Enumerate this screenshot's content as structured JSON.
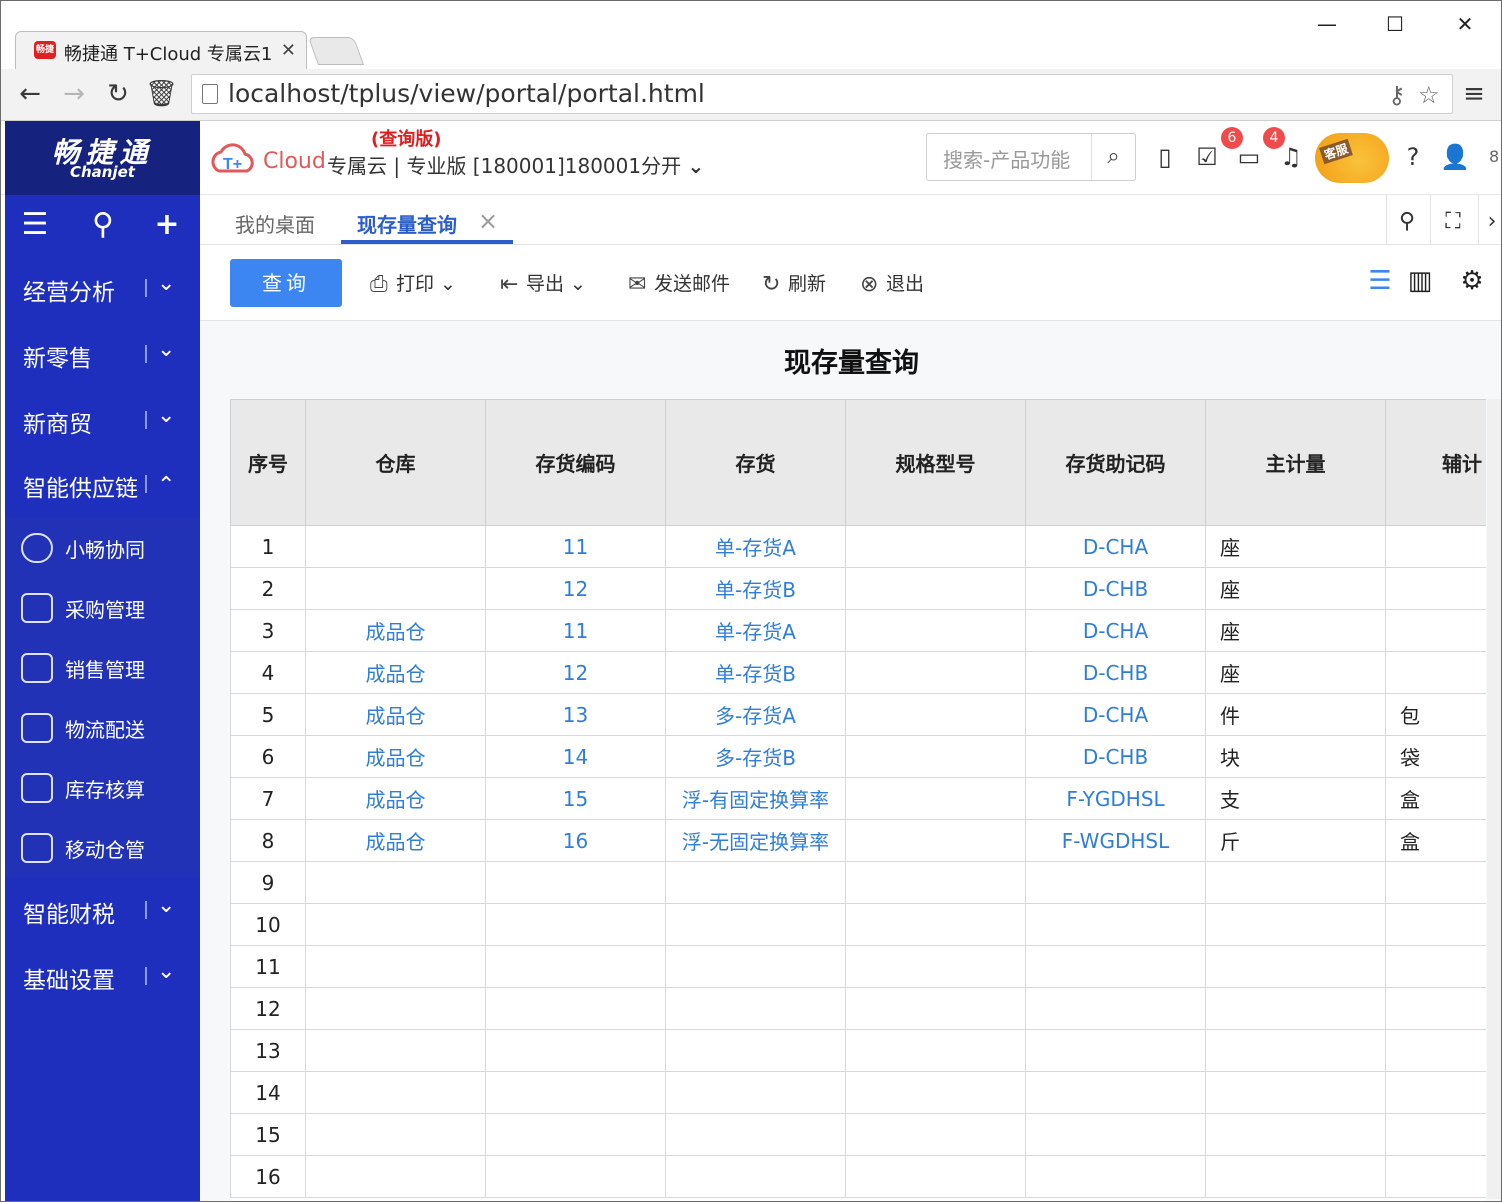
{
  "browser": {
    "tab_title": "畅捷通 T+Cloud 专属云1",
    "tab_favicon_text": "畅捷",
    "url": "localhost/tplus/view/portal/portal.html"
  },
  "app_header": {
    "brand_cn": "畅捷通",
    "brand_en": "Chanjet",
    "cloud_word": "Cloud",
    "edition_tag": "(查询版)",
    "product_line": "专属云 | 专业版 [180001]180001分开",
    "search_placeholder": "搜索-产品功能",
    "badge_messages": "6",
    "badge_notifications": "4",
    "kefu_label": "客服",
    "trailing_text": "8"
  },
  "sidebar": {
    "groups": [
      {
        "label": "经营分析",
        "expanded": false
      },
      {
        "label": "新零售",
        "expanded": false
      },
      {
        "label": "新商贸",
        "expanded": false
      },
      {
        "label": "智能供应链",
        "expanded": true
      },
      {
        "label": "智能财税",
        "expanded": false
      },
      {
        "label": "基础设置",
        "expanded": false
      }
    ],
    "sub_items": [
      {
        "label": "小畅协同",
        "icon": "collaboration-icon"
      },
      {
        "label": "采购管理",
        "icon": "purchase-icon"
      },
      {
        "label": "销售管理",
        "icon": "sales-chart-icon"
      },
      {
        "label": "物流配送",
        "icon": "truck-icon"
      },
      {
        "label": "库存核算",
        "icon": "inventory-icon"
      },
      {
        "label": "移动仓管",
        "icon": "mobile-warehouse-icon"
      }
    ]
  },
  "content_tabs": [
    {
      "label": "我的桌面",
      "active": false
    },
    {
      "label": "现存量查询",
      "active": true
    }
  ],
  "toolbar": {
    "query": "查询",
    "print": "打印",
    "export": "导出",
    "email": "发送邮件",
    "refresh": "刷新",
    "exit": "退出"
  },
  "report": {
    "title": "现存量查询",
    "columns": [
      "序号",
      "仓库",
      "存货编码",
      "存货",
      "规格型号",
      "存货助记码",
      "主计量",
      "辅计"
    ],
    "rows": [
      [
        "1",
        "",
        "11",
        "单-存货A",
        "",
        "D-CHA",
        "座",
        ""
      ],
      [
        "2",
        "",
        "12",
        "单-存货B",
        "",
        "D-CHB",
        "座",
        ""
      ],
      [
        "3",
        "成品仓",
        "11",
        "单-存货A",
        "",
        "D-CHA",
        "座",
        ""
      ],
      [
        "4",
        "成品仓",
        "12",
        "单-存货B",
        "",
        "D-CHB",
        "座",
        ""
      ],
      [
        "5",
        "成品仓",
        "13",
        "多-存货A",
        "",
        "D-CHA",
        "件",
        "包"
      ],
      [
        "6",
        "成品仓",
        "14",
        "多-存货B",
        "",
        "D-CHB",
        "块",
        "袋"
      ],
      [
        "7",
        "成品仓",
        "15",
        "浮-有固定换算率",
        "",
        "F-YGDHSL",
        "支",
        "盒"
      ],
      [
        "8",
        "成品仓",
        "16",
        "浮-无固定换算率",
        "",
        "F-WGDHSL",
        "斤",
        "盒"
      ],
      [
        "9",
        "",
        "",
        "",
        "",
        "",
        "",
        ""
      ],
      [
        "10",
        "",
        "",
        "",
        "",
        "",
        "",
        ""
      ],
      [
        "11",
        "",
        "",
        "",
        "",
        "",
        "",
        ""
      ],
      [
        "12",
        "",
        "",
        "",
        "",
        "",
        "",
        ""
      ],
      [
        "13",
        "",
        "",
        "",
        "",
        "",
        "",
        ""
      ],
      [
        "14",
        "",
        "",
        "",
        "",
        "",
        "",
        ""
      ],
      [
        "15",
        "",
        "",
        "",
        "",
        "",
        "",
        ""
      ],
      [
        "16",
        "",
        "",
        "",
        "",
        "",
        "",
        ""
      ]
    ]
  },
  "colors": {
    "sidebar_bg": "#1f2fbd",
    "brand_bg": "#16237e",
    "accent_blue": "#3b86f0",
    "link_blue": "#2f7ed8",
    "badge_red": "#f04b4b",
    "edition_red": "#e02020"
  }
}
